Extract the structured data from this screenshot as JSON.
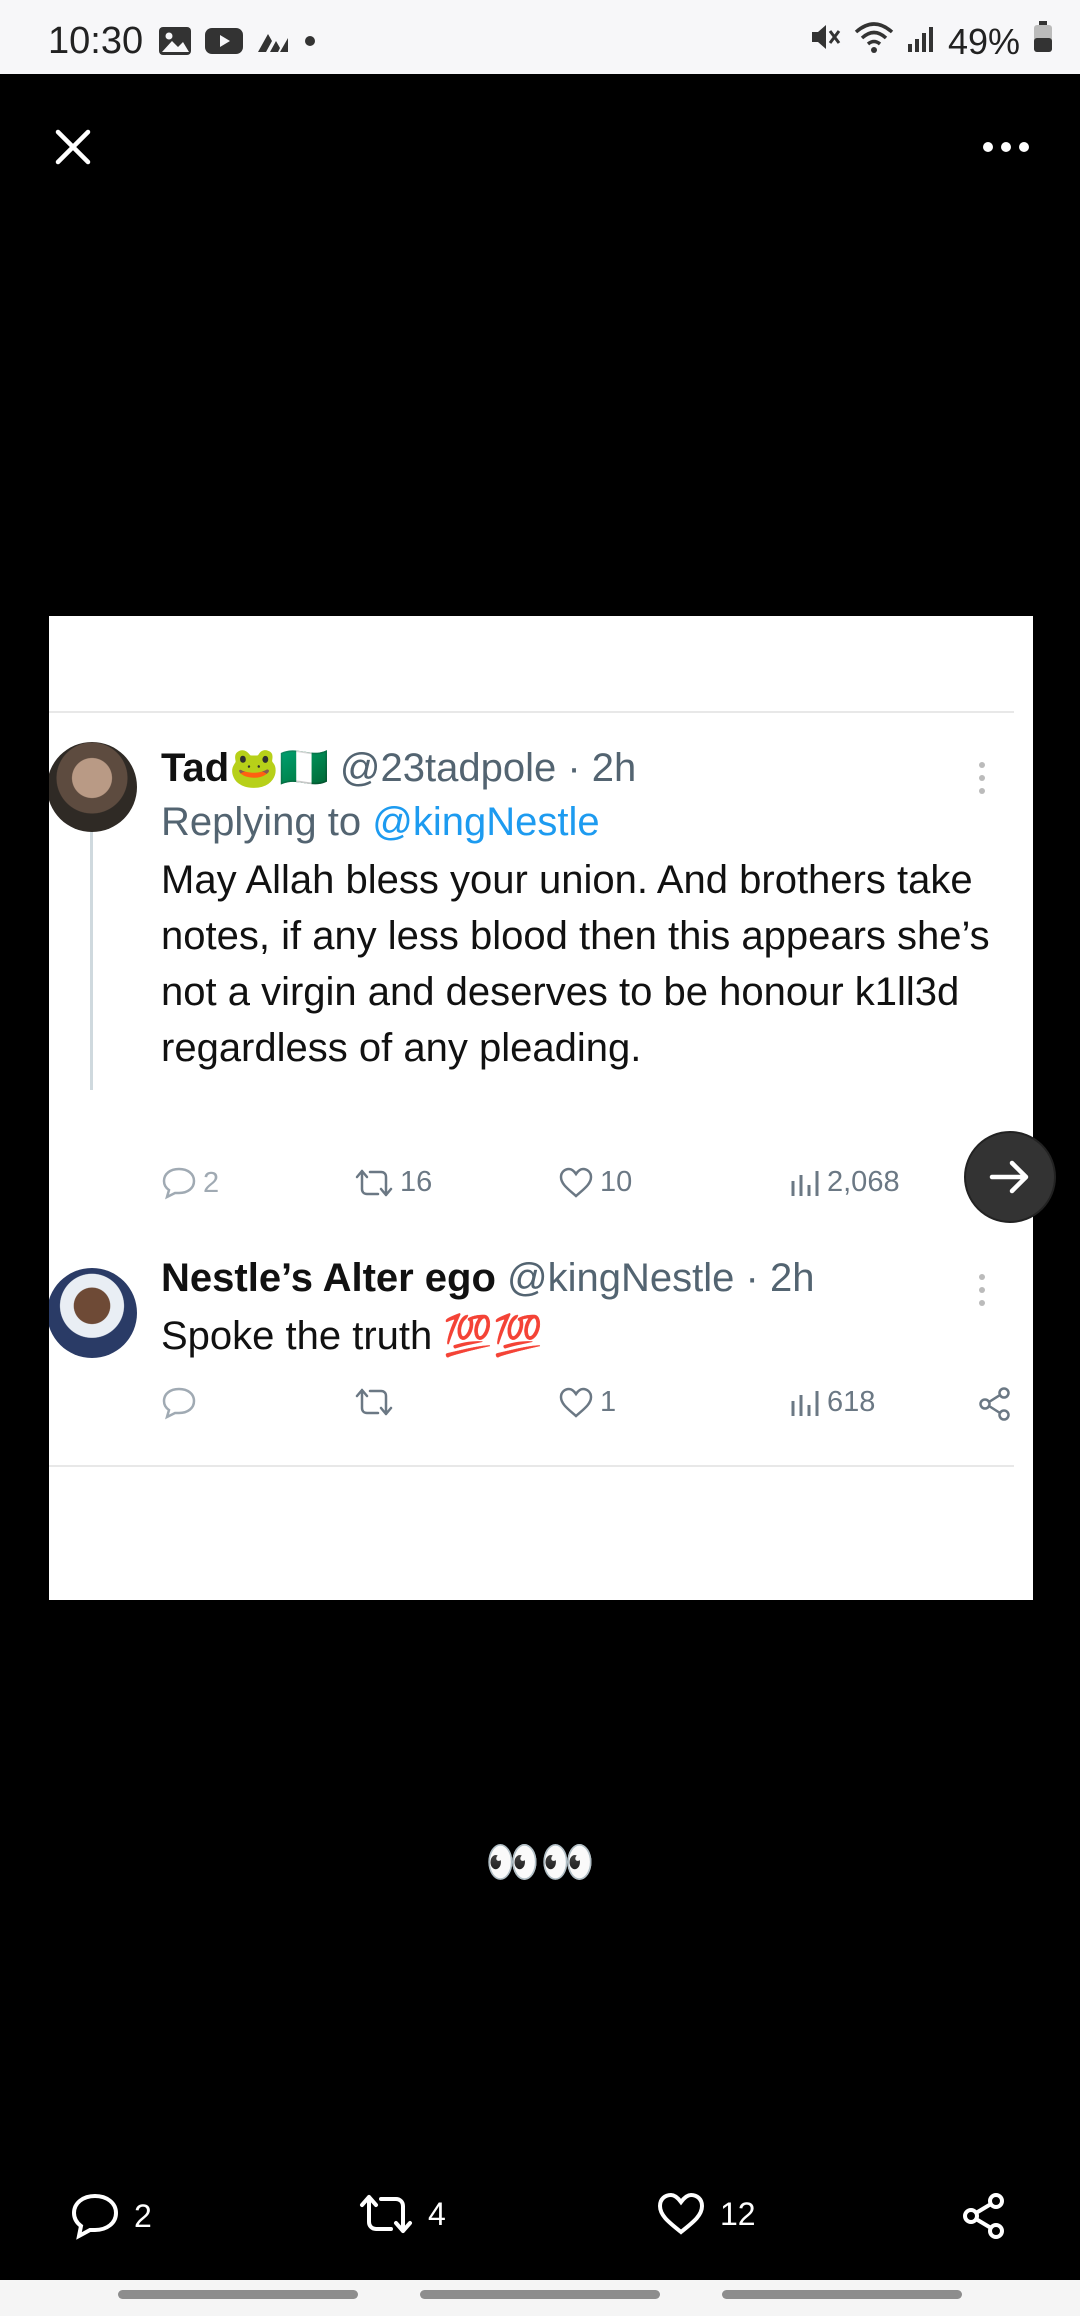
{
  "status_bar": {
    "time": "10:30",
    "battery": "49%"
  },
  "tweet1": {
    "name": "Tad",
    "emojis": "🐸🇳🇬",
    "handle": "@23tadpole",
    "time": "· 2h",
    "replying_prefix": "Replying to ",
    "replying_to": "@kingNestle",
    "text": "May Allah bless your union. And brothers take notes, if any less blood then this appears she’s not a virgin and deserves to be honour k1ll3d regardless of any pleading.",
    "replies": "2",
    "retweets": "16",
    "likes": "10",
    "views": "2,068"
  },
  "tweet2": {
    "name": "Nestle’s Alter ego",
    "handle": "@kingNestle",
    "time": "· 2h",
    "text": "Spoke the truth",
    "emoji": "💯💯",
    "replies": "",
    "retweets": "",
    "likes": "1",
    "views": "618"
  },
  "caption": "👀👀",
  "bottom_actions": {
    "comments": "2",
    "reposts": "4",
    "likes": "12"
  },
  "icons": [
    "close-icon",
    "more-icon",
    "next-arrow-icon",
    "comment-icon",
    "repost-icon",
    "heart-icon",
    "views-icon",
    "share-icon"
  ]
}
